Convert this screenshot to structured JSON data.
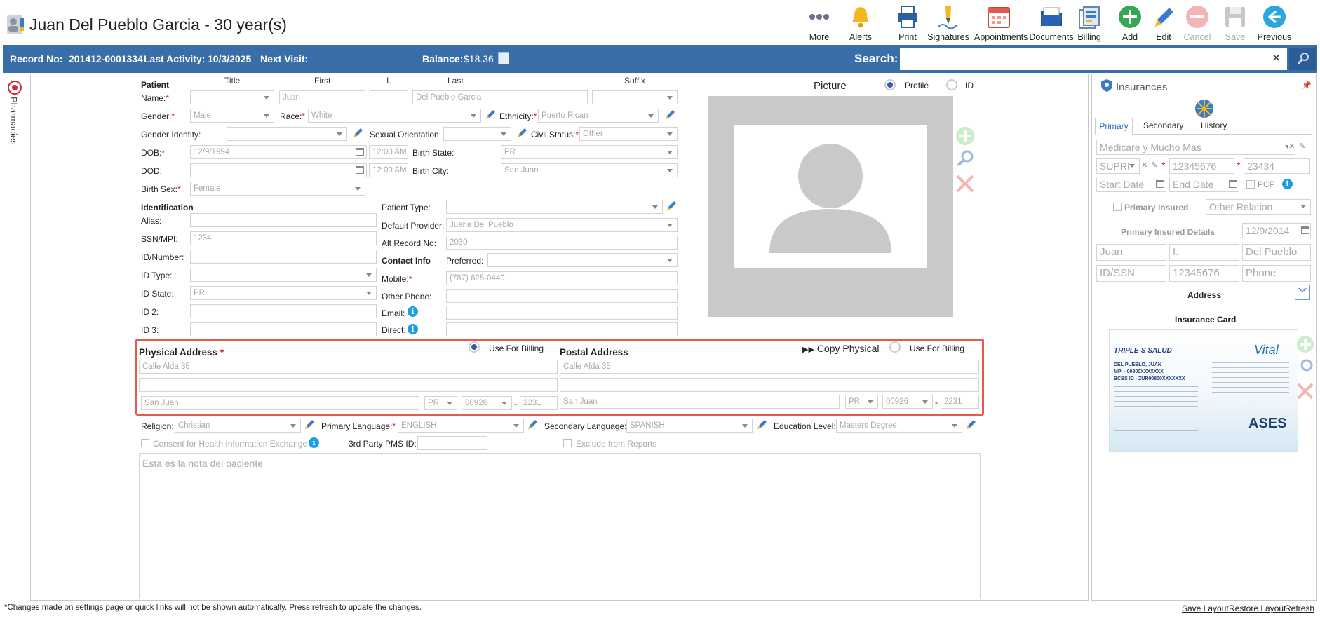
{
  "header": {
    "patient_title": "Juan Del Pueblo Garcia - 30 year(s)",
    "toolbar": [
      {
        "label": "More",
        "icon": "more-icon"
      },
      {
        "label": "Alerts",
        "icon": "bell-icon"
      },
      {
        "label": "Print",
        "icon": "printer-icon"
      },
      {
        "label": "Signatures",
        "icon": "signature-icon"
      },
      {
        "label": "Appointments",
        "icon": "calendar-icon"
      },
      {
        "label": "Documents",
        "icon": "documents-icon"
      },
      {
        "label": "Billing",
        "icon": "billing-icon"
      },
      {
        "label": "Add",
        "icon": "add-icon"
      },
      {
        "label": "Edit",
        "icon": "edit-icon"
      },
      {
        "label": "Cancel",
        "icon": "cancel-icon"
      },
      {
        "label": "Save",
        "icon": "save-icon"
      },
      {
        "label": "Previous",
        "icon": "previous-icon"
      }
    ]
  },
  "bar": {
    "record_label": "Record No:",
    "record_value": "201412-0001334",
    "activity_label": "Last Activity:",
    "activity_value": "10/3/2025",
    "next_label": "Next Visit:",
    "balance_label": "Balance:",
    "balance_value": "$18.36",
    "search_label": "Search:",
    "bar_color": "#3a6ea8"
  },
  "side_tab": "Pharmacies",
  "patient": {
    "section": "Patient",
    "col_title": "Title",
    "col_first": "First",
    "col_i": "I.",
    "col_last": "Last",
    "col_suffix": "Suffix",
    "name_label": "Name:",
    "first": "Juan",
    "last": "Del Pueblo Garcia",
    "gender_label": "Gender:",
    "gender": "Male",
    "race_label": "Race:",
    "race": "White",
    "ethnicity_label": "Ethnicity:",
    "ethnicity": "Puerto Rican",
    "gender_identity_label": "Gender Identity:",
    "sexual_orientation_label": "Sexual Orientation:",
    "civil_status_label": "Civil Status:",
    "civil_status": "Other",
    "dob_label": "DOB:",
    "dob": "12/9/1994",
    "dob_time": "12:00 AM",
    "birth_state_label": "Birth State:",
    "birth_state": "PR",
    "dod_label": "DOD:",
    "dod_time": "12:00 AM",
    "birth_city_label": "Birth City:",
    "birth_city": "San Juan",
    "birth_sex_label": "Birth Sex:",
    "birth_sex": "Female"
  },
  "identification": {
    "section": "Identification",
    "alias_label": "Alias:",
    "ssn_label": "SSN/MPI:",
    "ssn": "1234",
    "idnum_label": "ID/Number:",
    "idtype_label": "ID Type:",
    "idstate_label": "ID State:",
    "idstate": "PR",
    "id2_label": "ID 2:",
    "id3_label": "ID 3:",
    "patient_type_label": "Patient Type:",
    "default_provider_label": "Default Provider:",
    "default_provider": "Juana Del Pueblo",
    "alt_record_label": "Alt Record No:",
    "alt_record": "2030",
    "contact_section": "Contact Info",
    "preferred_label": "Preferred:",
    "mobile_label": "Mobile:",
    "mobile": "(787) 625-0440",
    "other_phone_label": "Other Phone:",
    "email_label": "Email:",
    "direct_label": "Direct:"
  },
  "picture": {
    "label": "Picture",
    "profile": "Profile",
    "id": "ID"
  },
  "physical": {
    "title": "Physical Address",
    "billing": "Use For Billing",
    "line1": "Calle Alda 35",
    "city": "San Juan",
    "state": "PR",
    "zip": "00926",
    "zip4": "2231"
  },
  "postal": {
    "title": "Postal Address",
    "copy": "Copy Physical",
    "billing": "Use For Billing",
    "line1": "Calle Alda 35",
    "city": "San Juan",
    "state": "PR",
    "zip": "00926",
    "zip4": "2231"
  },
  "misc": {
    "religion_label": "Religion:",
    "religion": "Christian",
    "primary_lang_label": "Primary Language:",
    "primary_lang": "ENGLISH",
    "secondary_lang_label": "Secondary Language:",
    "secondary_lang": "SPANISH",
    "education_label": "Education Level:",
    "education": "Masters Degree",
    "consent_label": "Consent for Health Information Exchange",
    "pms_label": "3rd Party PMS ID:",
    "exclude_label": "Exclude from Reports",
    "notes_placeholder": "Esta es la nota del paciente"
  },
  "insurance": {
    "title": "Insurances",
    "tabs": [
      "Primary",
      "Secondary",
      "History"
    ],
    "plan": "Medicare y Mucho Mas",
    "code": "SUPRI",
    "member": "12345676",
    "group": "23434",
    "start_ph": "Start Date",
    "end_ph": "End Date",
    "pcp": "PCP",
    "primary_insured": "Primary Insured",
    "other_relation": "Other Relation",
    "details": "Primary Insured Details",
    "details_date": "12/9/2014",
    "first": "Juan",
    "mi": "I.",
    "last": "Del Pueblo",
    "idssn_ph": "ID/SSN",
    "idssn2": "12345676",
    "phone_ph": "Phone",
    "address": "Address",
    "card": "Insurance Card",
    "card_lines": [
      "DEL PUEBLO, JUAN",
      "MPI - 00800XXXXXXX",
      "BCBS ID - ZUR00800XXXXXXX"
    ],
    "card_brand": "TRIPLE-S SALUD",
    "card_vital": "Vital",
    "card_ases": "ASES"
  },
  "footer": {
    "note": "*Changes made on settings page or quick links will not be shown automatically. Press refresh to update the changes.",
    "save_layout": "Save Layout",
    "restore_layout": "Restore Layout",
    "refresh": "Refresh"
  }
}
